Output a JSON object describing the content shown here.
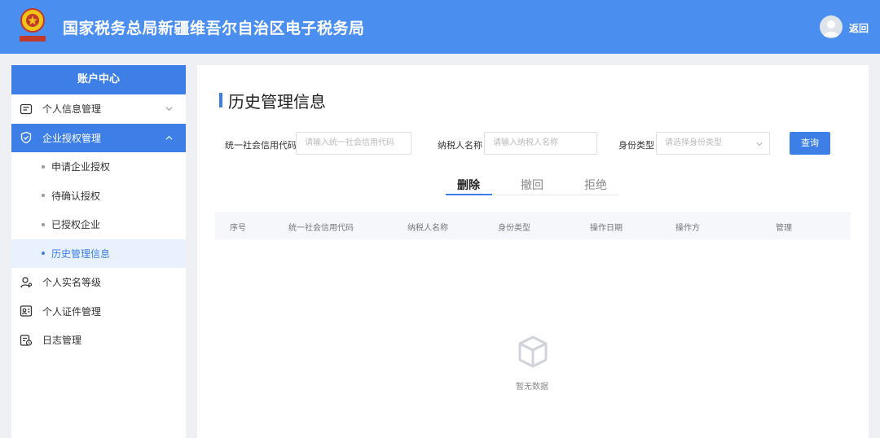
{
  "header": {
    "title": "国家税务总局新疆维吾尔自治区电子税务局",
    "back_label": "返回"
  },
  "sidebar": {
    "header": "账户中心",
    "items": [
      {
        "label": "个人信息管理",
        "icon": "profile-card-icon"
      },
      {
        "label": "企业授权管理",
        "icon": "authorize-check-icon"
      },
      {
        "label": "个人实名等级",
        "icon": "user-level-icon"
      },
      {
        "label": "个人证件管理",
        "icon": "id-card-icon"
      },
      {
        "label": "日志管理",
        "icon": "log-icon"
      }
    ],
    "subitems": [
      {
        "label": "申请企业授权"
      },
      {
        "label": "待确认授权"
      },
      {
        "label": "已授权企业"
      },
      {
        "label": "历史管理信息"
      }
    ]
  },
  "main": {
    "title": "历史管理信息",
    "filters": {
      "credit_code_label": "统一社会信用代码",
      "credit_code_placeholder": "请输入统一社会信用代码",
      "taxpayer_name_label": "纳税人名称",
      "taxpayer_name_placeholder": "请输入纳税人名称",
      "identity_type_label": "身份类型",
      "identity_type_placeholder": "请选择身份类型",
      "query_label": "查询"
    },
    "tabs": [
      {
        "label": "删除"
      },
      {
        "label": "撤回"
      },
      {
        "label": "拒绝"
      }
    ],
    "table": {
      "columns": [
        "序号",
        "统一社会信用代码",
        "纳税人名称",
        "身份类型",
        "操作日期",
        "操作方",
        "管理"
      ]
    },
    "empty_text": "暂无数据"
  },
  "colors": {
    "brand": "#4a8ef0",
    "accent": "#3d7fe6",
    "page_background": "#eef0f4"
  }
}
